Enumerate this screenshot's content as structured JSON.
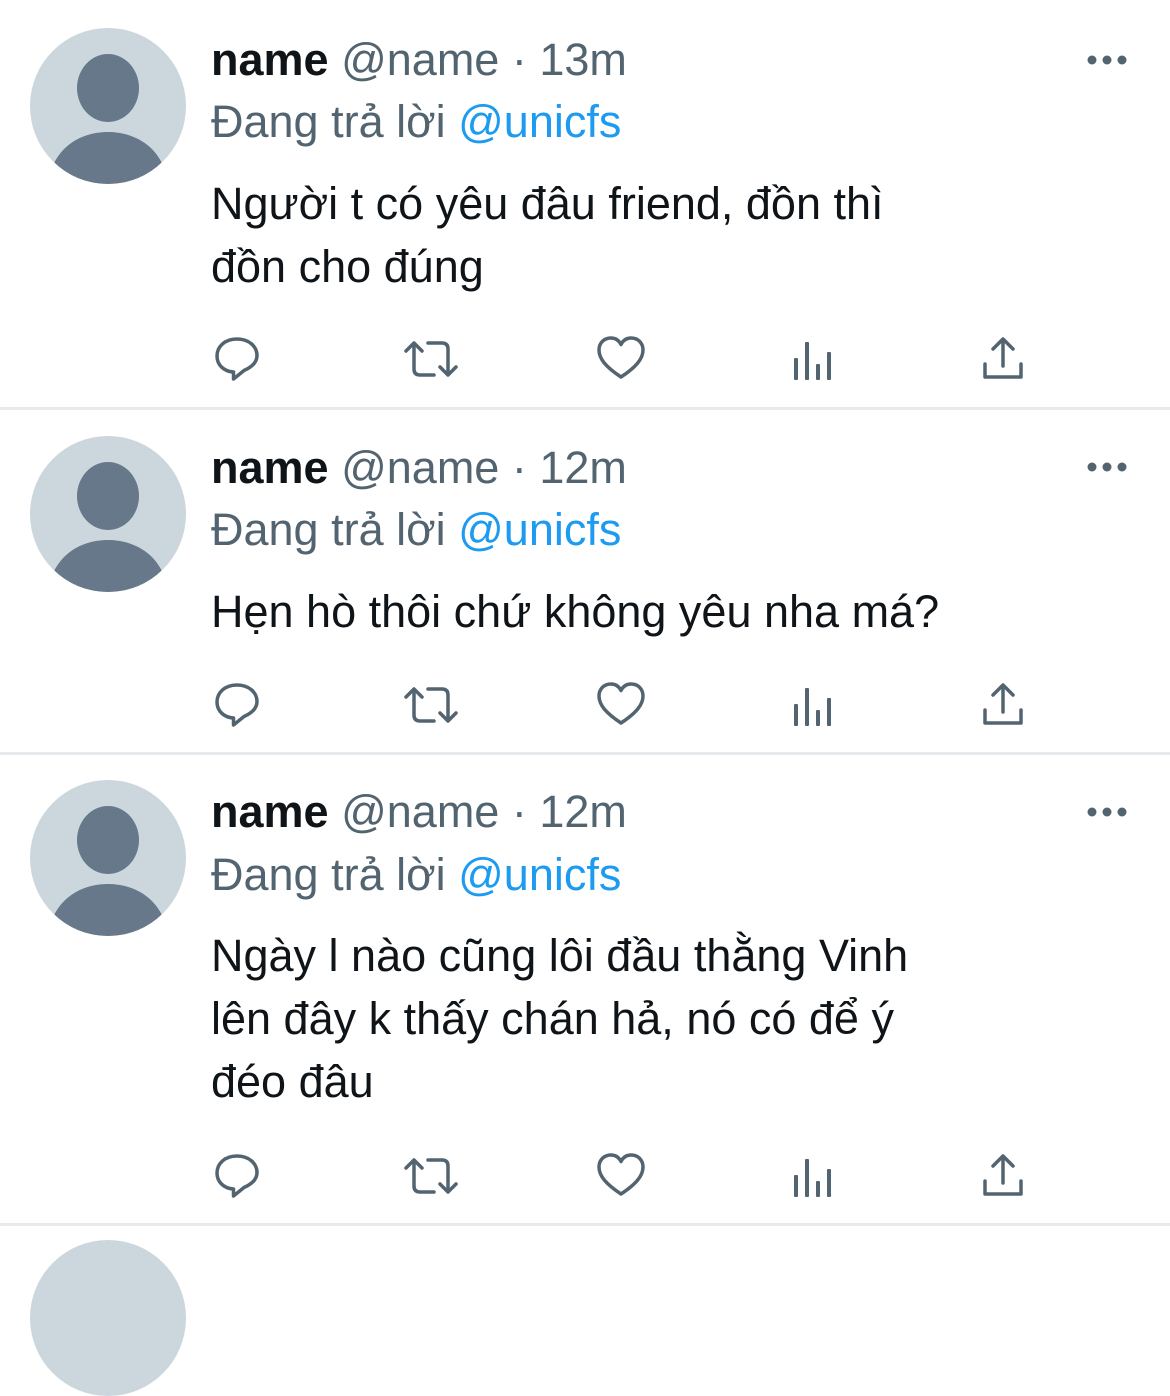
{
  "tweets": [
    {
      "display_name": "name",
      "handle": "@name",
      "separator": "·",
      "time": "13m",
      "reply_prefix": "Đang trả lời",
      "reply_to": "@unicfs",
      "text_lines": [
        "Người t có yêu đâu friend, đồn thì",
        "đồn cho đúng"
      ]
    },
    {
      "display_name": "name",
      "handle": "@name",
      "separator": "·",
      "time": "12m",
      "reply_prefix": "Đang trả lời",
      "reply_to": "@unicfs",
      "text_lines": [
        "Hẹn hò thôi chứ không yêu nha má?"
      ]
    },
    {
      "display_name": "name",
      "handle": "@name",
      "separator": "·",
      "time": "12m",
      "reply_prefix": "Đang trả lời",
      "reply_to": "@unicfs",
      "text_lines": [
        "Ngày l nào cũng lôi đầu thằng Vinh",
        "lên đây k thấy chán hả, nó có để ý",
        "đéo đâu"
      ]
    }
  ],
  "icons": {
    "more": "more-horizontal-icon",
    "reply": "reply-icon",
    "retweet": "retweet-icon",
    "like": "heart-icon",
    "analytics": "analytics-icon",
    "share": "share-icon"
  },
  "colors": {
    "text": "#0f1419",
    "secondary": "#536471",
    "mention": "#1d9bf0",
    "avatar_bg": "#ccd6dd",
    "avatar_fg": "#66788a",
    "divider": "#e8ebed"
  }
}
